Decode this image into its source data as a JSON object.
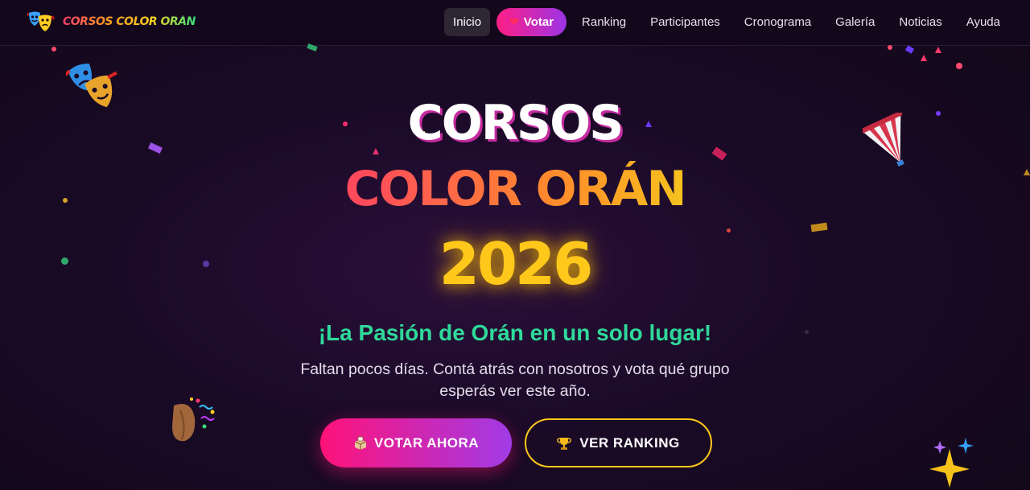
{
  "brand": {
    "name": "CORSOS COLOR ORÁN",
    "logo_icon": "theater-masks-icon"
  },
  "nav": {
    "items": [
      {
        "label": "Inicio",
        "active": true
      },
      {
        "label": "Votar",
        "icon": "heart-icon"
      },
      {
        "label": "Ranking"
      },
      {
        "label": "Participantes"
      },
      {
        "label": "Cronograma"
      },
      {
        "label": "Galería"
      },
      {
        "label": "Noticias"
      },
      {
        "label": "Ayuda"
      }
    ]
  },
  "hero": {
    "title_line1": "CORSOS",
    "title_line2": "COLOR ORÁN",
    "year": "2026",
    "tagline": "¡La Pasión de Orán en un solo lugar!",
    "subtext": "Faltan pocos días. Contá atrás con nosotros y vota qué grupo esperás ver este año.",
    "btn_vote": {
      "label": "VOTAR AHORA",
      "icon": "ballot-box-icon"
    },
    "btn_rank": {
      "label": "VER RANKING",
      "icon": "trophy-icon"
    }
  },
  "colors": {
    "accent_pink": "#ff1279",
    "accent_purple": "#a13be6",
    "accent_gold": "#ffc81a",
    "accent_green": "#2fd99a",
    "background": "#1a0a26"
  }
}
